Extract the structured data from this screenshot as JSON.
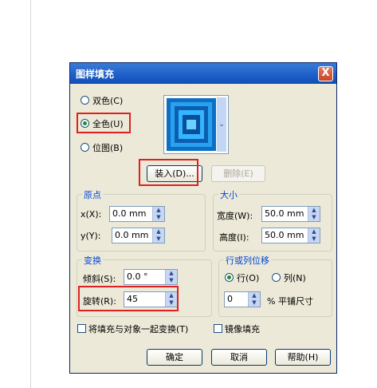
{
  "dialog": {
    "title": "图样填充",
    "close_label": "X"
  },
  "pattern_type": {
    "options": [
      {
        "label": "双色(C)",
        "selected": false
      },
      {
        "label": "全色(U)",
        "selected": true
      },
      {
        "label": "位图(B)",
        "selected": false
      }
    ]
  },
  "preview": {
    "dropdown_glyph": "⌄"
  },
  "actions": {
    "load_label": "装入(D)...",
    "delete_label": "删除(E)"
  },
  "origin": {
    "group_title": "原点",
    "x_label": "x(X):",
    "x_value": "0.0 mm",
    "y_label": "y(Y):",
    "y_value": "0.0 mm"
  },
  "size": {
    "group_title": "大小",
    "width_label": "宽度(W):",
    "width_value": "50.0 mm",
    "height_label": "高度(I):",
    "height_value": "50.0 mm"
  },
  "transform": {
    "group_title": "变换",
    "skew_label": "倾斜(S):",
    "skew_value": "0.0 °",
    "rotate_label": "旋转(R):",
    "rotate_value": "45"
  },
  "offset": {
    "group_title": "行或列位移",
    "row_label": "行(O)",
    "column_label": "列(N)",
    "row_selected": true,
    "value": "0",
    "unit_label": "% 平铺尺寸"
  },
  "options": {
    "transform_with_object_label": "将填充与对象一起变换(T)",
    "mirror_fill_label": "镜像填充"
  },
  "footer": {
    "ok_label": "确定",
    "cancel_label": "取消",
    "help_label": "帮助(H)"
  },
  "colors": {
    "title_bar": "#1d5ec7",
    "highlight_box": "#e02020",
    "pattern_blue": "#1f8fe0"
  }
}
